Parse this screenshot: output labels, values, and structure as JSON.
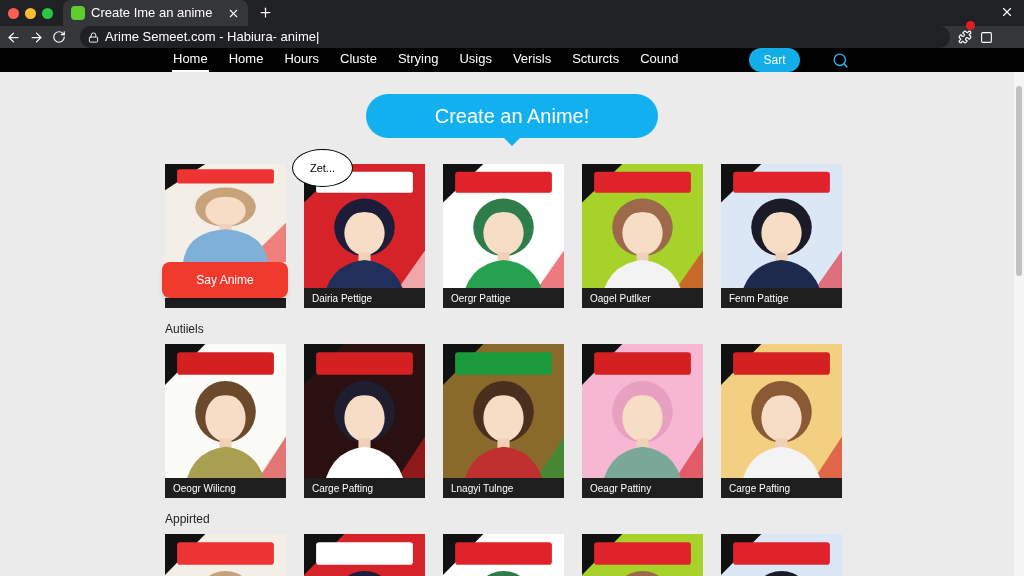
{
  "browser": {
    "tab": {
      "title": "Create Ime an anime"
    },
    "url": "Arime Semeet.com - Habiura- anime|"
  },
  "nav": {
    "items": [
      {
        "label": "Home",
        "selected": true
      },
      {
        "label": "Home",
        "selected": false
      },
      {
        "label": "Hours",
        "selected": false
      },
      {
        "label": "Cluste",
        "selected": false
      },
      {
        "label": "Strying",
        "selected": false
      },
      {
        "label": "Usigs",
        "selected": false
      },
      {
        "label": "Verisls",
        "selected": false
      },
      {
        "label": "Scturcts",
        "selected": false
      },
      {
        "label": "Cound",
        "selected": false
      }
    ],
    "button": "Sart"
  },
  "banner": "Create an Anime!",
  "sections": [
    {
      "cards": [
        {
          "kind": "picture",
          "button": "Say Anime"
        },
        {
          "kind": "picture",
          "caption": "Dairia Pettige",
          "bubble": "Zet..."
        },
        {
          "kind": "picture",
          "caption": "Oergr Pattige"
        },
        {
          "kind": "picture",
          "caption": "Oagel Putlker"
        },
        {
          "kind": "picture",
          "caption": "Fenm Pattige"
        }
      ]
    },
    {
      "heading": "Autiiels",
      "cards": [
        {
          "kind": "picture",
          "caption": "Oeogr Wilicng"
        },
        {
          "kind": "picture",
          "caption": "Carge Pafting"
        },
        {
          "kind": "picture",
          "caption": "Lnagyi Tulnge"
        },
        {
          "kind": "picture",
          "caption": "Oeagr Pattiny"
        },
        {
          "kind": "picture",
          "caption": "Carge Pafting"
        }
      ]
    },
    {
      "heading": "Appirted"
    }
  ]
}
